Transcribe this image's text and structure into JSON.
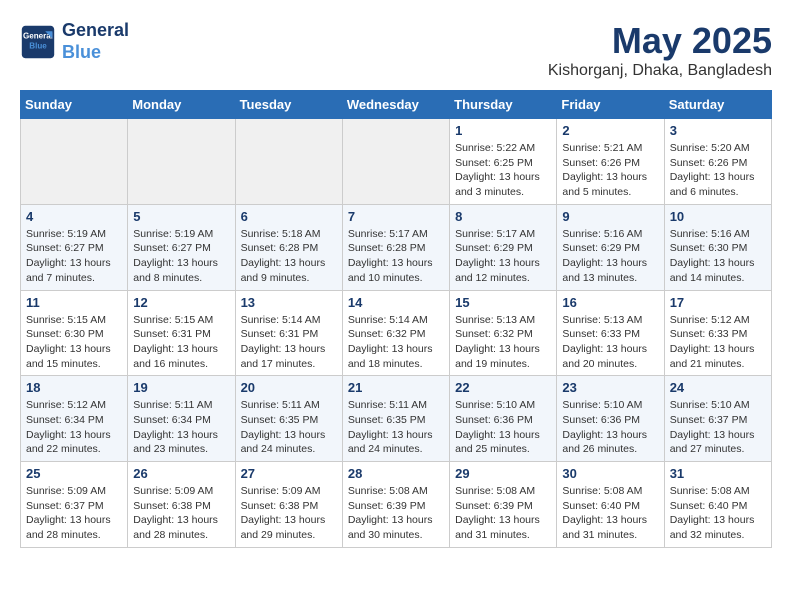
{
  "logo": {
    "line1": "General",
    "line2": "Blue"
  },
  "title": "May 2025",
  "location": "Kishorganj, Dhaka, Bangladesh",
  "weekdays": [
    "Sunday",
    "Monday",
    "Tuesday",
    "Wednesday",
    "Thursday",
    "Friday",
    "Saturday"
  ],
  "weeks": [
    [
      {
        "day": "",
        "info": ""
      },
      {
        "day": "",
        "info": ""
      },
      {
        "day": "",
        "info": ""
      },
      {
        "day": "",
        "info": ""
      },
      {
        "day": "1",
        "info": "Sunrise: 5:22 AM\nSunset: 6:25 PM\nDaylight: 13 hours\nand 3 minutes."
      },
      {
        "day": "2",
        "info": "Sunrise: 5:21 AM\nSunset: 6:26 PM\nDaylight: 13 hours\nand 5 minutes."
      },
      {
        "day": "3",
        "info": "Sunrise: 5:20 AM\nSunset: 6:26 PM\nDaylight: 13 hours\nand 6 minutes."
      }
    ],
    [
      {
        "day": "4",
        "info": "Sunrise: 5:19 AM\nSunset: 6:27 PM\nDaylight: 13 hours\nand 7 minutes."
      },
      {
        "day": "5",
        "info": "Sunrise: 5:19 AM\nSunset: 6:27 PM\nDaylight: 13 hours\nand 8 minutes."
      },
      {
        "day": "6",
        "info": "Sunrise: 5:18 AM\nSunset: 6:28 PM\nDaylight: 13 hours\nand 9 minutes."
      },
      {
        "day": "7",
        "info": "Sunrise: 5:17 AM\nSunset: 6:28 PM\nDaylight: 13 hours\nand 10 minutes."
      },
      {
        "day": "8",
        "info": "Sunrise: 5:17 AM\nSunset: 6:29 PM\nDaylight: 13 hours\nand 12 minutes."
      },
      {
        "day": "9",
        "info": "Sunrise: 5:16 AM\nSunset: 6:29 PM\nDaylight: 13 hours\nand 13 minutes."
      },
      {
        "day": "10",
        "info": "Sunrise: 5:16 AM\nSunset: 6:30 PM\nDaylight: 13 hours\nand 14 minutes."
      }
    ],
    [
      {
        "day": "11",
        "info": "Sunrise: 5:15 AM\nSunset: 6:30 PM\nDaylight: 13 hours\nand 15 minutes."
      },
      {
        "day": "12",
        "info": "Sunrise: 5:15 AM\nSunset: 6:31 PM\nDaylight: 13 hours\nand 16 minutes."
      },
      {
        "day": "13",
        "info": "Sunrise: 5:14 AM\nSunset: 6:31 PM\nDaylight: 13 hours\nand 17 minutes."
      },
      {
        "day": "14",
        "info": "Sunrise: 5:14 AM\nSunset: 6:32 PM\nDaylight: 13 hours\nand 18 minutes."
      },
      {
        "day": "15",
        "info": "Sunrise: 5:13 AM\nSunset: 6:32 PM\nDaylight: 13 hours\nand 19 minutes."
      },
      {
        "day": "16",
        "info": "Sunrise: 5:13 AM\nSunset: 6:33 PM\nDaylight: 13 hours\nand 20 minutes."
      },
      {
        "day": "17",
        "info": "Sunrise: 5:12 AM\nSunset: 6:33 PM\nDaylight: 13 hours\nand 21 minutes."
      }
    ],
    [
      {
        "day": "18",
        "info": "Sunrise: 5:12 AM\nSunset: 6:34 PM\nDaylight: 13 hours\nand 22 minutes."
      },
      {
        "day": "19",
        "info": "Sunrise: 5:11 AM\nSunset: 6:34 PM\nDaylight: 13 hours\nand 23 minutes."
      },
      {
        "day": "20",
        "info": "Sunrise: 5:11 AM\nSunset: 6:35 PM\nDaylight: 13 hours\nand 24 minutes."
      },
      {
        "day": "21",
        "info": "Sunrise: 5:11 AM\nSunset: 6:35 PM\nDaylight: 13 hours\nand 24 minutes."
      },
      {
        "day": "22",
        "info": "Sunrise: 5:10 AM\nSunset: 6:36 PM\nDaylight: 13 hours\nand 25 minutes."
      },
      {
        "day": "23",
        "info": "Sunrise: 5:10 AM\nSunset: 6:36 PM\nDaylight: 13 hours\nand 26 minutes."
      },
      {
        "day": "24",
        "info": "Sunrise: 5:10 AM\nSunset: 6:37 PM\nDaylight: 13 hours\nand 27 minutes."
      }
    ],
    [
      {
        "day": "25",
        "info": "Sunrise: 5:09 AM\nSunset: 6:37 PM\nDaylight: 13 hours\nand 28 minutes."
      },
      {
        "day": "26",
        "info": "Sunrise: 5:09 AM\nSunset: 6:38 PM\nDaylight: 13 hours\nand 28 minutes."
      },
      {
        "day": "27",
        "info": "Sunrise: 5:09 AM\nSunset: 6:38 PM\nDaylight: 13 hours\nand 29 minutes."
      },
      {
        "day": "28",
        "info": "Sunrise: 5:08 AM\nSunset: 6:39 PM\nDaylight: 13 hours\nand 30 minutes."
      },
      {
        "day": "29",
        "info": "Sunrise: 5:08 AM\nSunset: 6:39 PM\nDaylight: 13 hours\nand 31 minutes."
      },
      {
        "day": "30",
        "info": "Sunrise: 5:08 AM\nSunset: 6:40 PM\nDaylight: 13 hours\nand 31 minutes."
      },
      {
        "day": "31",
        "info": "Sunrise: 5:08 AM\nSunset: 6:40 PM\nDaylight: 13 hours\nand 32 minutes."
      }
    ]
  ]
}
